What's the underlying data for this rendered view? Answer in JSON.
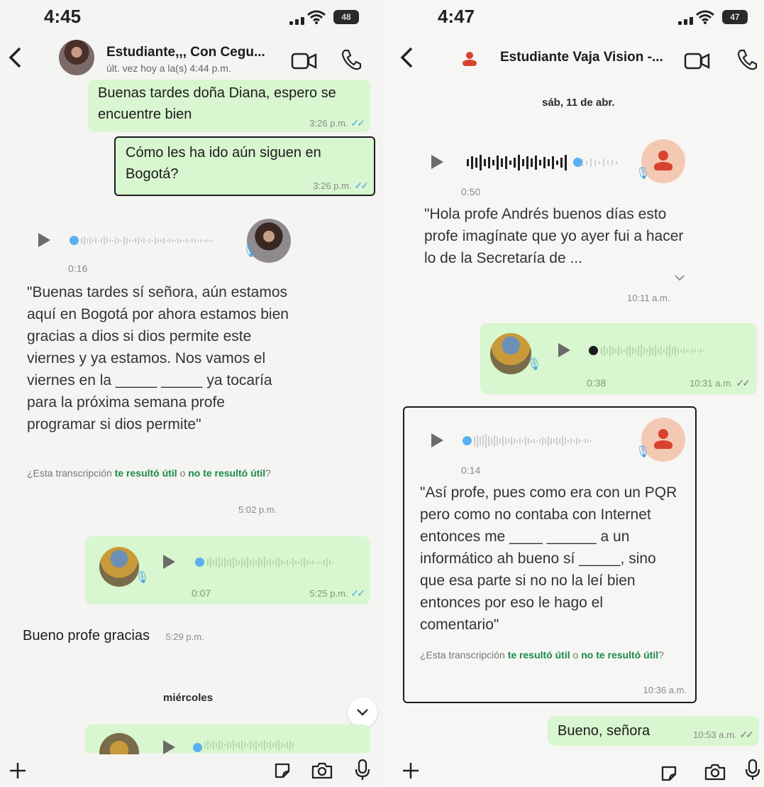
{
  "left": {
    "status_time": "4:45",
    "battery": "48",
    "contact_name": "Estudiante,,, Con Cegu...",
    "last_seen": "últ. vez hoy a la(s) 4:44 p.m.",
    "messages": {
      "m1_text": "Buenas tardes doña Diana, espero se encuentre bien",
      "m1_time": "3:26 p.m.",
      "m2_text": "Cómo les ha ido aún siguen en Bogotá?",
      "m2_time": "3:26 p.m.",
      "voice1_duration": "0:16",
      "voice1_transcript": "\"Buenas tardes sí señora, aún estamos aquí en Bogotá por ahora estamos bien gracias a dios si dios permite este viernes y ya estamos. Nos vamos el viernes en la _____ _____ ya tocaría para la próxima semana profe programar si dios permite\"",
      "feedback_prefix": "¿Esta transcripción ",
      "feedback_yes": "te resultó útil",
      "feedback_or": " o ",
      "feedback_no": "no te resultó útil",
      "feedback_suffix": "?",
      "voice1_time": "5:02 p.m.",
      "voice2_duration": "0:07",
      "voice2_time": "5:25 p.m.",
      "m3_text": "Bueno profe gracias",
      "m3_time": "5:29 p.m."
    },
    "day_label": "miércoles"
  },
  "right": {
    "status_time": "4:47",
    "battery": "47",
    "contact_name": "Estudiante Vaja Vision -...",
    "date_label": "sáb, 11 de abr.",
    "voice1_duration": "0:50",
    "voice1_transcript": "\"Hola profe Andrés buenos días esto profe imagínate que yo ayer fui a hacer lo de la Secretaría de ...",
    "voice1_time": "10:11 a.m.",
    "voice2_duration": "0:38",
    "voice2_time": "10:31 a.m.",
    "voice3_duration": "0:14",
    "voice3_transcript": "\"Así profe, pues como era con un PQR pero como no contaba con Internet entonces me ____ ______ a un informático ah bueno sí _____, sino que esa parte si no no la leí bien entonces por eso le hago el comentario\"",
    "feedback_prefix": "¿Esta transcripción ",
    "feedback_yes": "te resultó útil",
    "feedback_or": " o ",
    "feedback_no": "no te resultó útil",
    "feedback_suffix": "?",
    "voice3_time": "10:36 a.m.",
    "m_out_text": "Bueno, señora",
    "m_out_time": "10:53 a.m."
  },
  "icons": {
    "back": "chevron-left-icon",
    "video": "video-camera-icon",
    "call": "phone-icon",
    "plus": "plus-icon",
    "sticker": "sticker-icon",
    "camera": "camera-icon",
    "mic": "microphone-icon"
  }
}
